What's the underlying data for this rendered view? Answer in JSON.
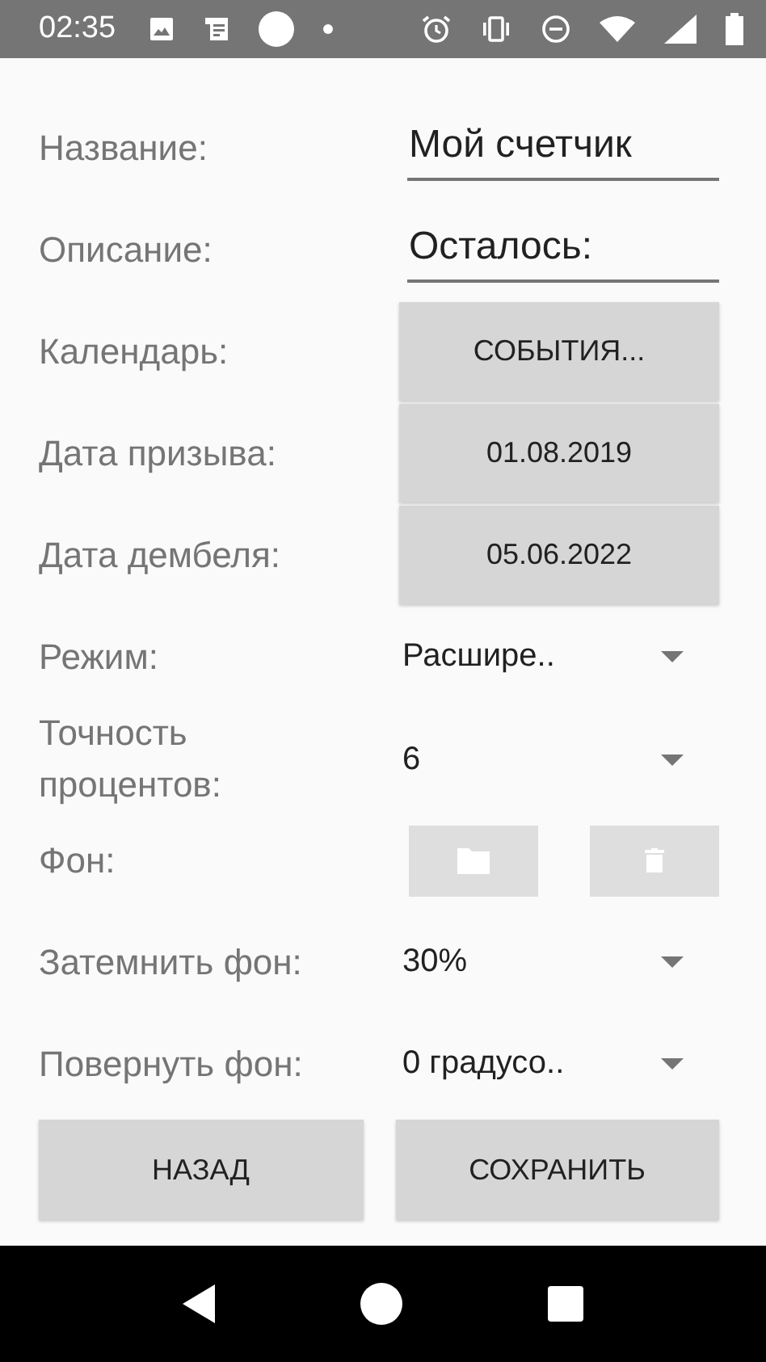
{
  "status_bar": {
    "time": "02:35"
  },
  "fields": [
    {
      "kind": "text_input",
      "label": "Название:",
      "value": "Мой счетчик"
    },
    {
      "kind": "text_input",
      "label": "Описание:",
      "value": "Осталось:"
    },
    {
      "kind": "button",
      "label": "Календарь:",
      "button": "СОБЫТИЯ..."
    },
    {
      "kind": "button",
      "label": "Дата призыва:",
      "button": "01.08.2019"
    },
    {
      "kind": "button",
      "label": "Дата дембеля:",
      "button": "05.06.2022"
    },
    {
      "kind": "dropdown",
      "label": "Режим:",
      "value": "Расшире.."
    },
    {
      "kind": "dropdown",
      "label": "Точность процентов:",
      "value": "6"
    },
    {
      "kind": "icon_buttons",
      "label": "Фон:",
      "buttons": [
        {
          "disabled": true
        },
        {
          "disabled": true
        }
      ]
    },
    {
      "kind": "dropdown",
      "label": "Затемнить фон:",
      "value": "30%"
    },
    {
      "kind": "dropdown",
      "label": "Повернуть фон:",
      "value": "0 градусо.."
    }
  ],
  "actions": [
    "НАЗАД",
    "СОХРАНИТЬ"
  ]
}
